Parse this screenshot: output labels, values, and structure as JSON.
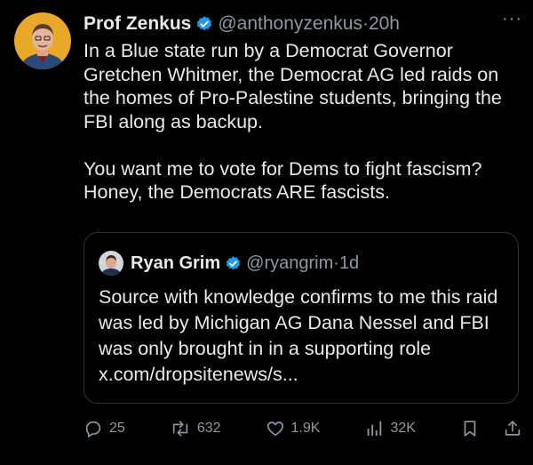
{
  "tweet": {
    "author_name": "Prof Zenkus",
    "handle": "@anthonyzenkus",
    "separator": "·",
    "time": "20h",
    "more": "···",
    "paragraphs": [
      "In a Blue state run by a Democrat Governor Gretchen Whitmer, the Democrat AG led raids on the homes of Pro-Palestine students, bringing the FBI along as backup.",
      "You want me to vote for Dems to fight fascism? Honey, the Democrats ARE fascists."
    ]
  },
  "quoted_tweet": {
    "author_name": "Ryan Grim",
    "handle": "@ryangrim",
    "separator": "·",
    "time": "1d",
    "text": "Source with knowledge confirms to me this raid was led by Michigan AG Dana Nessel and FBI was only brought in in a supporting role x.com/dropsitenews/s..."
  },
  "actions": {
    "replies": "25",
    "reposts": "632",
    "likes": "1.9K",
    "views": "32K"
  },
  "colors": {
    "background": "#000000",
    "text": "#e7e9ea",
    "muted": "#8b98a5",
    "verified": "#1d9bf0",
    "border": "#2f3336"
  },
  "icons": [
    "verified-badge-icon",
    "more-icon",
    "reply-icon",
    "repost-icon",
    "like-icon",
    "views-icon",
    "bookmark-icon",
    "share-icon"
  ]
}
